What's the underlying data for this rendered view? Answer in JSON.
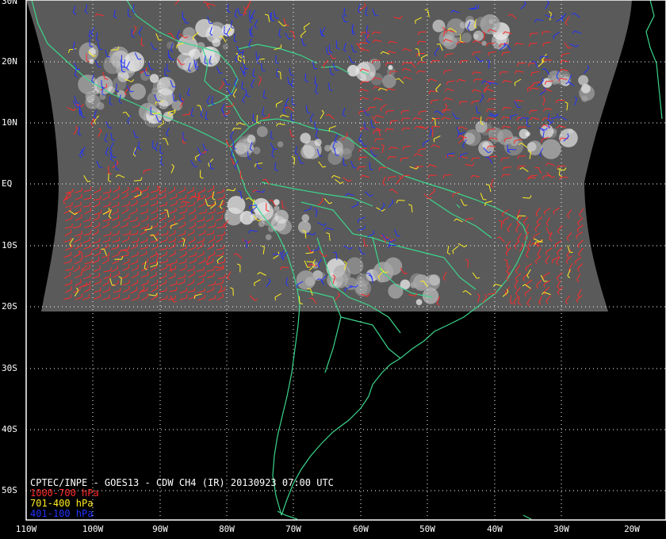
{
  "map": {
    "lat_labels": [
      "30N",
      "20N",
      "10N",
      "EQ",
      "10S",
      "20S",
      "30S",
      "40S",
      "50S"
    ],
    "lon_labels": [
      "110W",
      "100W",
      "90W",
      "80W",
      "70W",
      "60W",
      "50W",
      "40W",
      "30W",
      "20W"
    ],
    "colors": {
      "background": "#000000",
      "coastline": "#3cd68c",
      "grid": "#ffffff",
      "low_level_wind": "#ff2a2a",
      "mid_level_wind": "#ffee22",
      "high_level_wind": "#2233ff",
      "satellite_imagery": "#5a5a5a"
    },
    "caption": {
      "title": "CPTEC/INPE - GOES13 - CDW CH4 (IR) 20130923 07:00 UTC",
      "legend": [
        {
          "label": "1000-700 hPa",
          "color": "#ff2a2a"
        },
        {
          "label": "701-400 hPa",
          "color": "#ffee22"
        },
        {
          "label": "401-100 hPa",
          "color": "#2233ff"
        }
      ]
    }
  }
}
